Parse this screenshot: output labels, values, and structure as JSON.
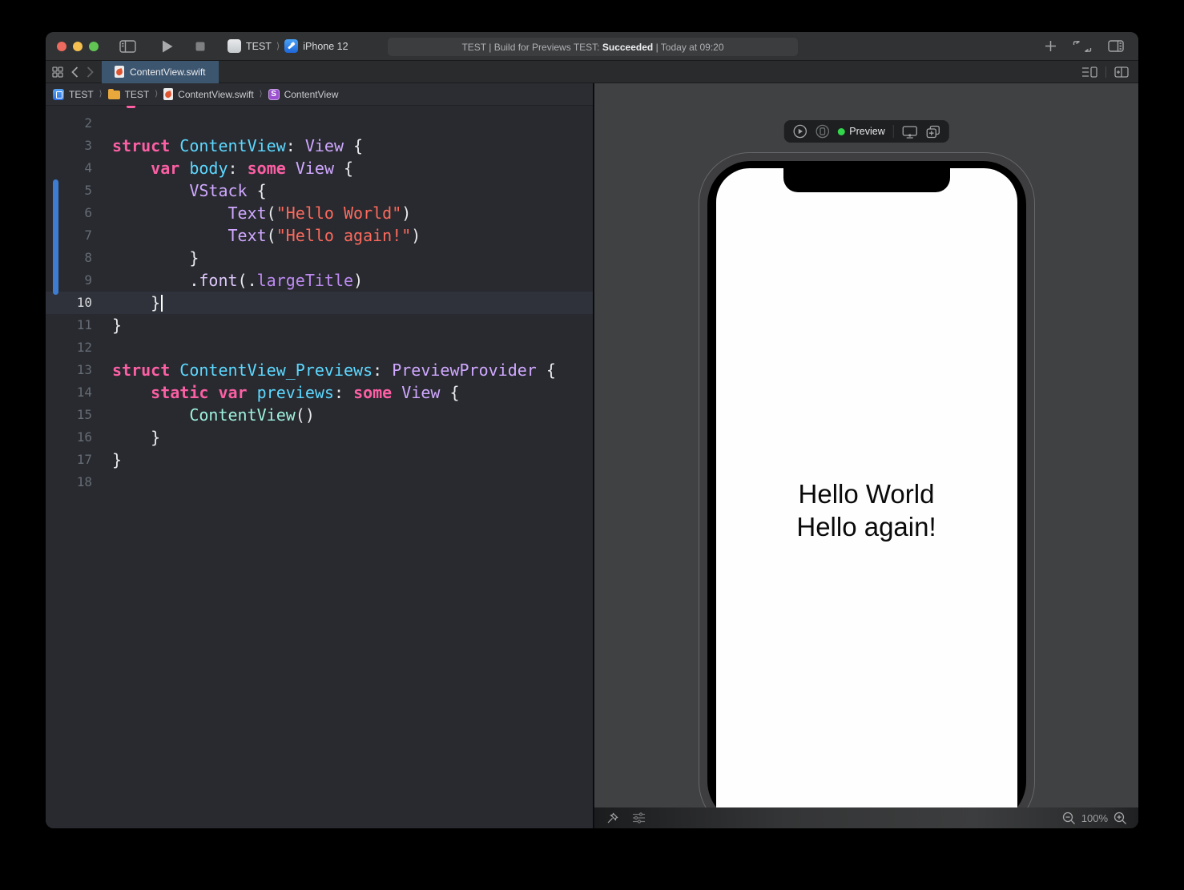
{
  "toolbar": {
    "scheme_project": "TEST",
    "scheme_separator": "⟩",
    "scheme_device": "iPhone 12",
    "status": {
      "prefix": "TEST | Build for Previews TEST: ",
      "bold": "Succeeded",
      "suffix": " | Today at 09:20"
    }
  },
  "tabbar": {
    "active_tab": "ContentView.swift"
  },
  "breadcrumb": {
    "separator": "⟩",
    "items": [
      "TEST",
      "TEST",
      "ContentView.swift",
      "ContentView"
    ]
  },
  "editor": {
    "background": "#282A30",
    "current_line_color": "#2F323A",
    "change_bar_color": "#3E7CD1",
    "token_colors": {
      "kw": "#FC5FA3",
      "td": "#5DD8FF",
      "tp": "#D0A8FF",
      "st": "#FC6A5D",
      "mb": "#BD8AF0",
      "fn": "#DEC7FA",
      "pj": "#9EF1DD",
      "pl": "#E9EAEC",
      "num": "#666C74"
    },
    "lines": [
      {
        "n": 2,
        "tokens": []
      },
      {
        "n": 3,
        "tokens": [
          [
            "kw",
            "struct"
          ],
          [
            "pl",
            " "
          ],
          [
            "td",
            "ContentView"
          ],
          [
            "pl",
            ": "
          ],
          [
            "tp",
            "View"
          ],
          [
            "pl",
            " {"
          ]
        ]
      },
      {
        "n": 4,
        "tokens": [
          [
            "pl",
            "    "
          ],
          [
            "kw",
            "var"
          ],
          [
            "pl",
            " "
          ],
          [
            "td",
            "body"
          ],
          [
            "pl",
            ": "
          ],
          [
            "kw",
            "some"
          ],
          [
            "pl",
            " "
          ],
          [
            "tp",
            "View"
          ],
          [
            "pl",
            " {"
          ]
        ]
      },
      {
        "n": 5,
        "changed": true,
        "tokens": [
          [
            "pl",
            "        "
          ],
          [
            "tp",
            "VStack"
          ],
          [
            "pl",
            " {"
          ]
        ]
      },
      {
        "n": 6,
        "changed": true,
        "tokens": [
          [
            "pl",
            "            "
          ],
          [
            "tp",
            "Text"
          ],
          [
            "pl",
            "("
          ],
          [
            "st",
            "\"Hello World\""
          ],
          [
            "pl",
            ")"
          ]
        ]
      },
      {
        "n": 7,
        "changed": true,
        "tokens": [
          [
            "pl",
            "            "
          ],
          [
            "tp",
            "Text"
          ],
          [
            "pl",
            "("
          ],
          [
            "st",
            "\"Hello again!\""
          ],
          [
            "pl",
            ")"
          ]
        ]
      },
      {
        "n": 8,
        "changed": true,
        "tokens": [
          [
            "pl",
            "        }"
          ]
        ]
      },
      {
        "n": 9,
        "changed": true,
        "tokens": [
          [
            "pl",
            "        ."
          ],
          [
            "fn",
            "font"
          ],
          [
            "pl",
            "(."
          ],
          [
            "mb",
            "largeTitle"
          ],
          [
            "pl",
            ")"
          ]
        ]
      },
      {
        "n": 10,
        "current": true,
        "cursor": true,
        "tokens": [
          [
            "pl",
            "    }"
          ]
        ]
      },
      {
        "n": 11,
        "tokens": [
          [
            "pl",
            "}"
          ]
        ]
      },
      {
        "n": 12,
        "tokens": []
      },
      {
        "n": 13,
        "tokens": [
          [
            "kw",
            "struct"
          ],
          [
            "pl",
            " "
          ],
          [
            "td",
            "ContentView_Previews"
          ],
          [
            "pl",
            ": "
          ],
          [
            "tp",
            "PreviewProvider"
          ],
          [
            "pl",
            " {"
          ]
        ]
      },
      {
        "n": 14,
        "tokens": [
          [
            "pl",
            "    "
          ],
          [
            "kw",
            "static"
          ],
          [
            "pl",
            " "
          ],
          [
            "kw",
            "var"
          ],
          [
            "pl",
            " "
          ],
          [
            "td",
            "previews"
          ],
          [
            "pl",
            ": "
          ],
          [
            "kw",
            "some"
          ],
          [
            "pl",
            " "
          ],
          [
            "tp",
            "View"
          ],
          [
            "pl",
            " {"
          ]
        ]
      },
      {
        "n": 15,
        "tokens": [
          [
            "pl",
            "        "
          ],
          [
            "pj",
            "ContentView"
          ],
          [
            "pl",
            "()"
          ]
        ]
      },
      {
        "n": 16,
        "tokens": [
          [
            "pl",
            "    }"
          ]
        ]
      },
      {
        "n": 17,
        "tokens": [
          [
            "pl",
            "}"
          ]
        ]
      },
      {
        "n": 18,
        "tokens": []
      }
    ]
  },
  "preview": {
    "toolbar": {
      "label": "Preview",
      "status_color": "#32D74B"
    },
    "device": {
      "name": "iPhone 12",
      "screen_lines": [
        "Hello World",
        "Hello again!"
      ]
    },
    "bottombar": {
      "zoom_level": "100%"
    }
  }
}
